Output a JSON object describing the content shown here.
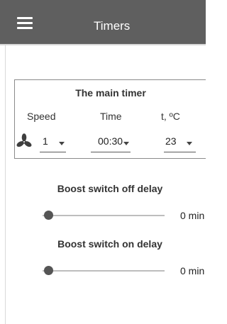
{
  "app_bar": {
    "title": "Timers",
    "menu_icon": "hamburger-menu-icon",
    "background_color": "#5f5f5f",
    "text_color": "#ffffff"
  },
  "main_timer": {
    "title": "The main timer",
    "speed": {
      "label": "Speed",
      "icon": "fan-icon",
      "value": "1"
    },
    "time": {
      "label": "Time",
      "value": "00:30"
    },
    "temperature": {
      "label": "t, ºC",
      "value": "23"
    }
  },
  "boost_off_delay": {
    "title": "Boost switch off delay",
    "value_text": "0 min",
    "fraction": 0
  },
  "boost_on_delay": {
    "title": "Boost switch on delay",
    "value_text": "0 min",
    "fraction": 0
  },
  "colors": {
    "accent": "#555555",
    "track": "#bdbdbd"
  }
}
